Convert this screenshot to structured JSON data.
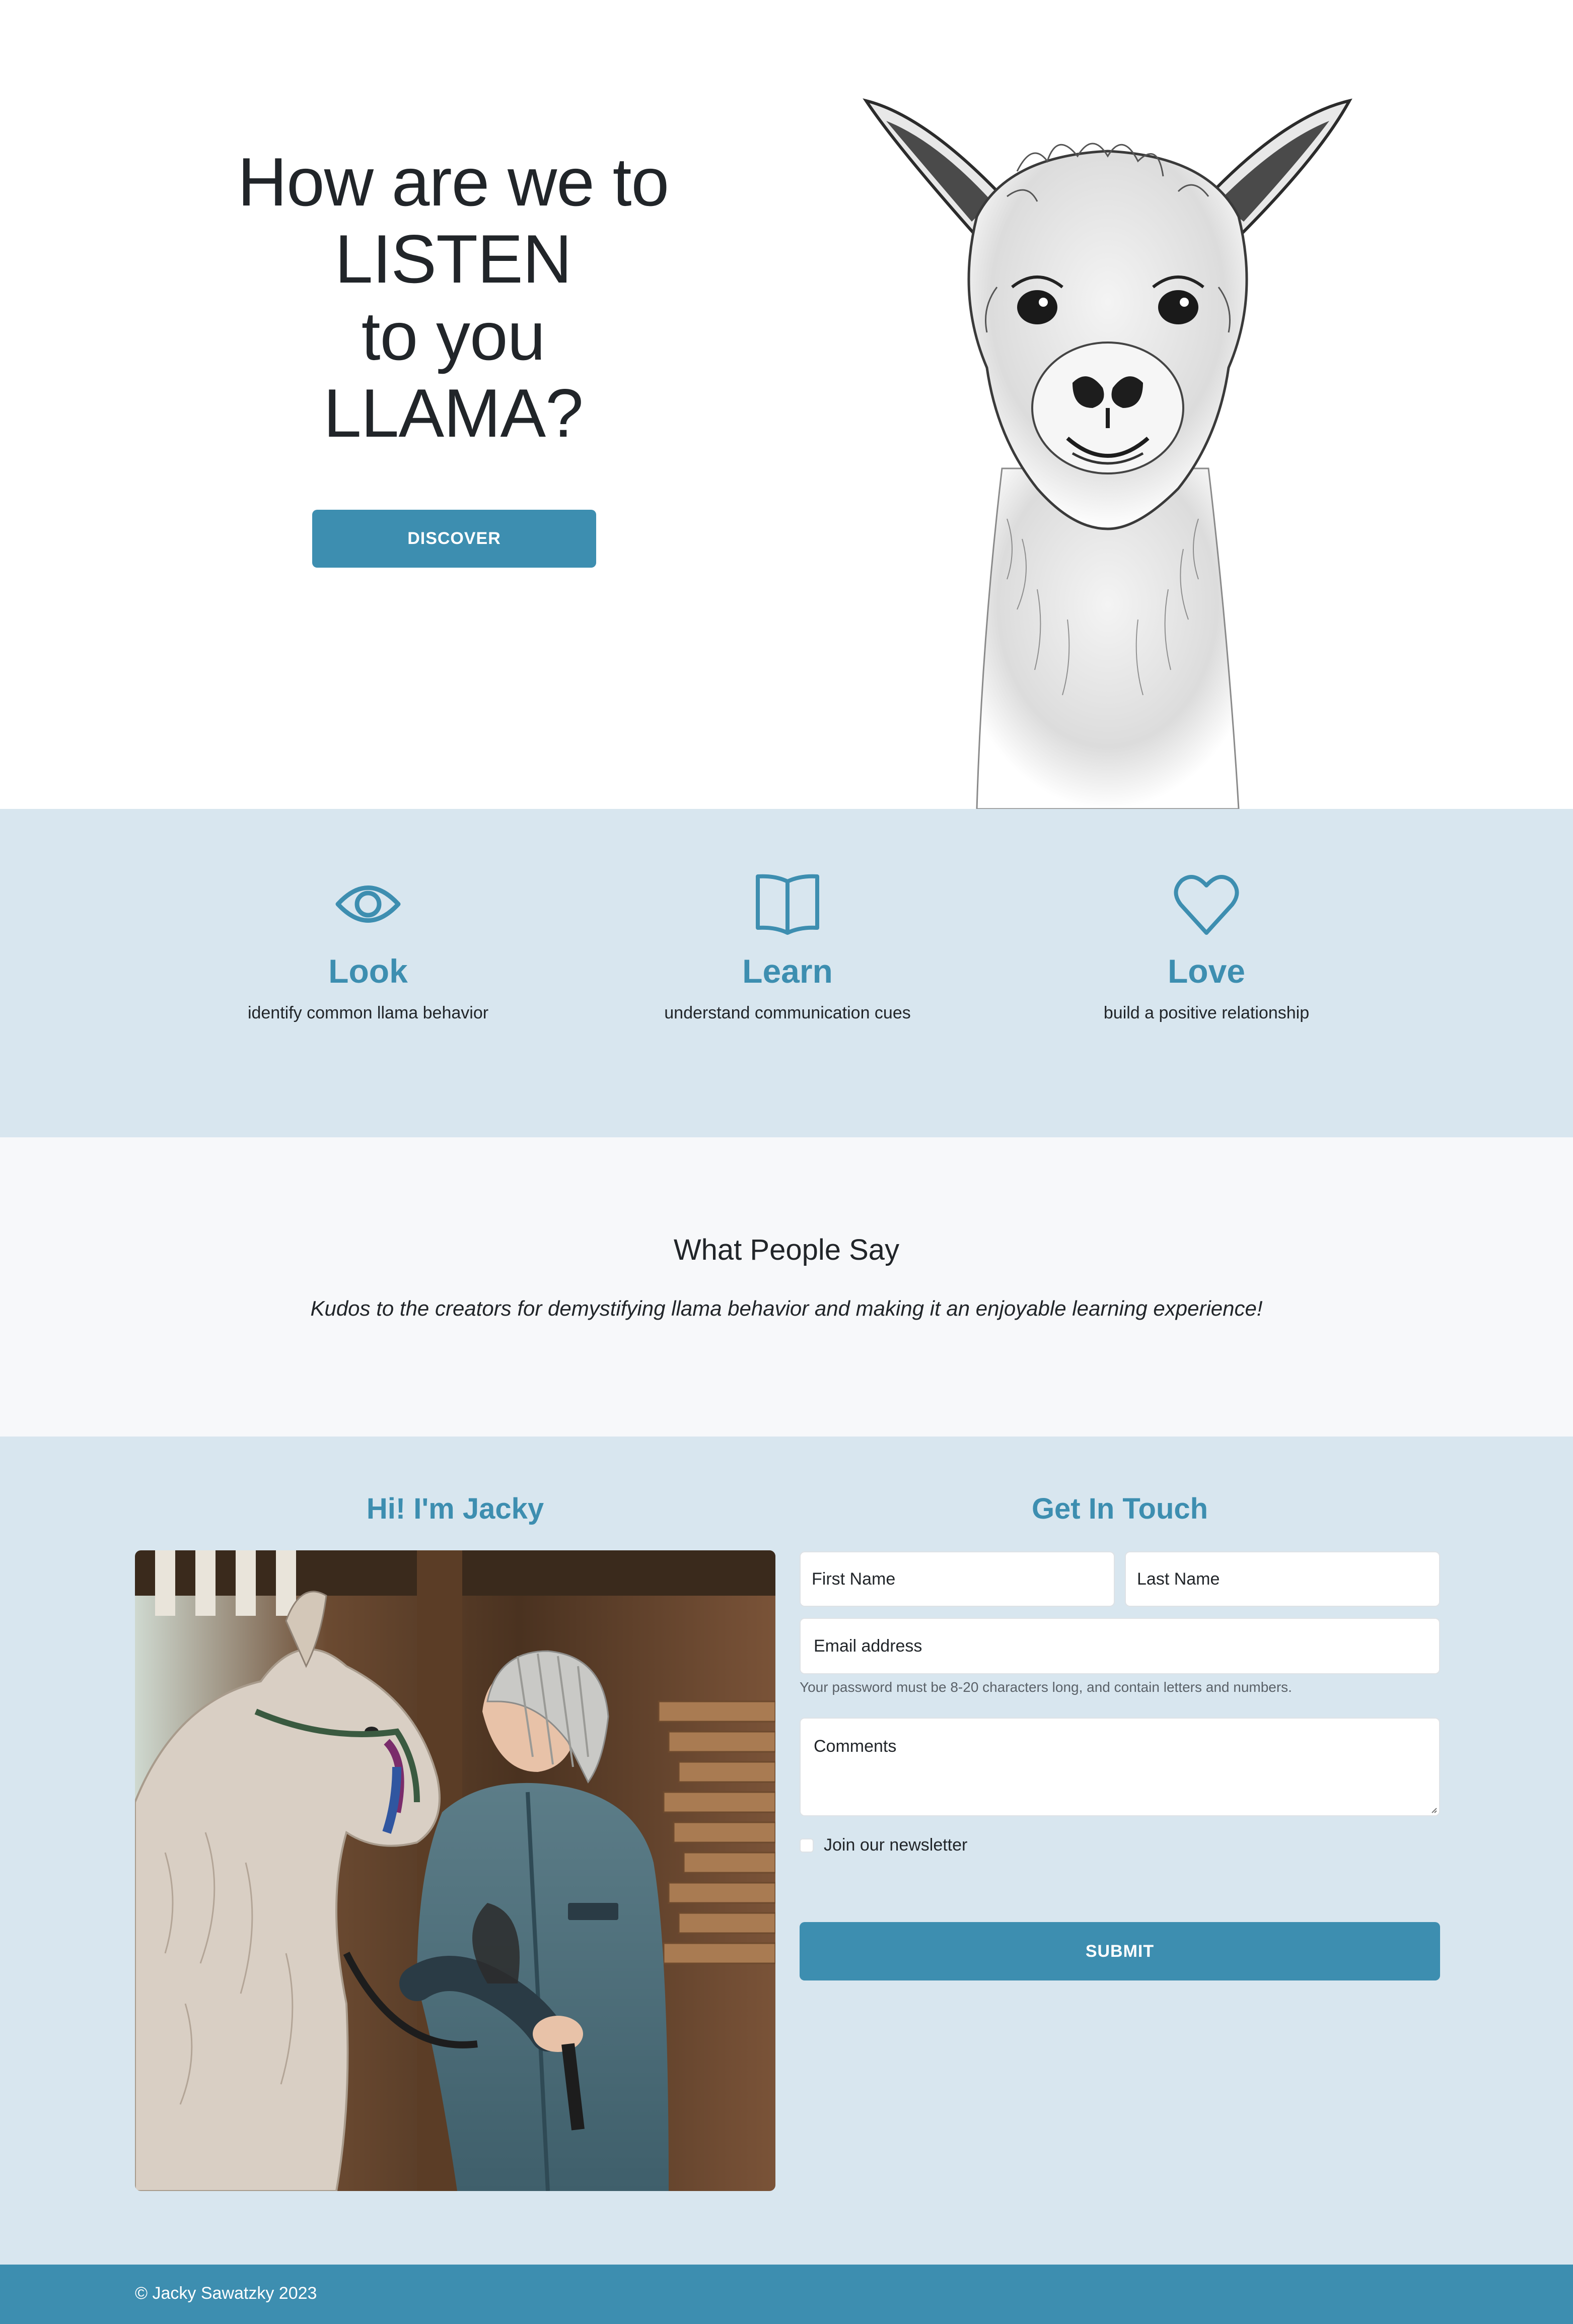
{
  "hero": {
    "title_lines": [
      "How are we to",
      "LISTEN",
      "to you",
      "LLAMA?"
    ],
    "button_label": "DISCOVER"
  },
  "features": [
    {
      "icon": "eye-icon",
      "title": "Look",
      "desc": "identify common llama behavior"
    },
    {
      "icon": "book-icon",
      "title": "Learn",
      "desc": "understand communication cues"
    },
    {
      "icon": "heart-icon",
      "title": "Love",
      "desc": "build a positive relationship"
    }
  ],
  "testimonial": {
    "heading": "What People Say",
    "quote": "Kudos to the creators for demystifying llama behavior and making it an enjoyable learning experience!"
  },
  "about": {
    "heading": "Hi! I'm Jacky"
  },
  "contact": {
    "heading": "Get In Touch",
    "first_name_placeholder": "First Name",
    "last_name_placeholder": "Last Name",
    "email_placeholder": "Email address",
    "help_text": "Your password must be 8-20 characters long, and contain letters and numbers.",
    "comments_placeholder": "Comments",
    "newsletter_label": "Join our newsletter",
    "submit_label": "SUBMIT"
  },
  "footer": {
    "copyright": "© Jacky Sawatzky 2023"
  },
  "colors": {
    "accent": "#3d8eb0",
    "section_bg": "#d8e6ef",
    "testimonial_bg": "#f7f8fa"
  }
}
